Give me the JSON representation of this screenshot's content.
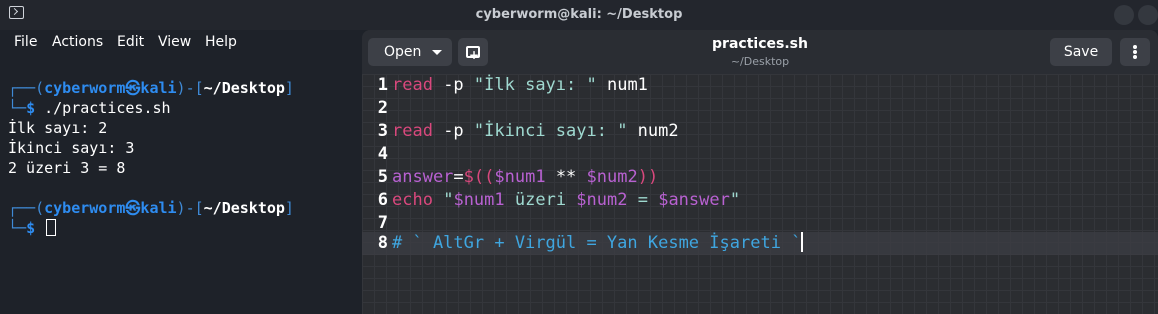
{
  "window": {
    "title": "cyberworm@kali: ~/Desktop"
  },
  "terminal": {
    "menu": [
      "File",
      "Actions",
      "Edit",
      "View",
      "Help"
    ],
    "prompt_user": "cyberworm",
    "prompt_host": "kali",
    "prompt_dir": "~/Desktop",
    "command": "./practices.sh",
    "output": [
      "İlk sayı: 2",
      "İkinci sayı: 3",
      "2 üzeri 3 = 8"
    ]
  },
  "editor": {
    "open_label": "Open",
    "save_label": "Save",
    "doc_title": "practices.sh",
    "doc_path": "~/Desktop",
    "line_numbers": [
      "1",
      "2",
      "3",
      "4",
      "5",
      "6",
      "7",
      "8"
    ],
    "lines": {
      "l1": {
        "kw": "read",
        "flag": " -p ",
        "str": "\"İlk sayı: \"",
        "rest": " num1"
      },
      "l3": {
        "kw": "read",
        "flag": " -p ",
        "str": "\"İkinci sayı: \"",
        "rest": " num2"
      },
      "l5": {
        "a": "answer",
        "eq": "=",
        "b": "$((",
        "c": "$num1",
        "d": " ** ",
        "e": "$num2",
        "f": "))"
      },
      "l6": {
        "kw": "echo",
        "sp": " ",
        "s1": "\"",
        "v1": "$num1",
        "s2": " üzeri ",
        "v2": "$num2",
        "s3": " = ",
        "v3": "$answer",
        "s4": "\""
      },
      "l8": {
        "comment": "# ` AltGr + Virgül = Yan Kesme İşareti `"
      }
    }
  },
  "colors": {
    "keyword": "#d9487d",
    "string": "#9fd9d0",
    "variable": "#b861d1",
    "comment": "#3fa6e0",
    "prompt": "#2e8cf0"
  },
  "icons": {
    "terminal": "terminal-icon",
    "new_tab": "new-tab-icon",
    "menu": "hamburger-menu-icon",
    "dropdown": "chevron-down-icon"
  }
}
